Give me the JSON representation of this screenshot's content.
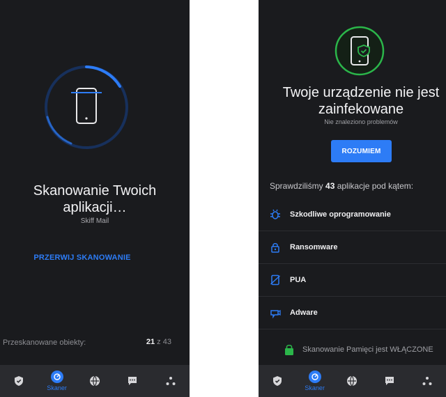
{
  "left_screen": {
    "title_line1": "Skanowanie Twoich",
    "title_line2": "aplikacji…",
    "current_app": "Skiff Mail",
    "stop_button": "PRZERWIJ SKANOWANIE",
    "scanned_label": "Przeskanowane obiekty:",
    "scanned_current": "21",
    "scanned_sep": " z ",
    "scanned_total": "43"
  },
  "right_screen": {
    "title_line1": "Twoje urządzenie nie jest",
    "title_line2": "zainfekowane",
    "subtitle": "Nie znaleziono problemów",
    "ok_button": "ROZUMIEM",
    "checked_prefix": "Sprawdziliśmy ",
    "checked_count": "43",
    "checked_suffix": " aplikacje pod kątem:",
    "threats": [
      {
        "label": "Szkodliwe oprogramowanie",
        "icon": "bug-icon"
      },
      {
        "label": "Ransomware",
        "icon": "lock-icon"
      },
      {
        "label": "PUA",
        "icon": "crossed-app-icon"
      },
      {
        "label": "Adware",
        "icon": "ad-icon"
      }
    ],
    "memory_toast": "Skanowanie Pamięci jest WŁĄCZONE"
  },
  "bottom_nav": {
    "active_label": "Skaner",
    "items": [
      "shield-icon",
      "scanner-icon",
      "globe-icon",
      "chat-icon",
      "more-icon"
    ]
  },
  "colors": {
    "background": "#1a1b1e",
    "nav_background": "#2a2b2f",
    "accent_blue": "#2d7cf6",
    "success_green": "#2bb64a"
  }
}
